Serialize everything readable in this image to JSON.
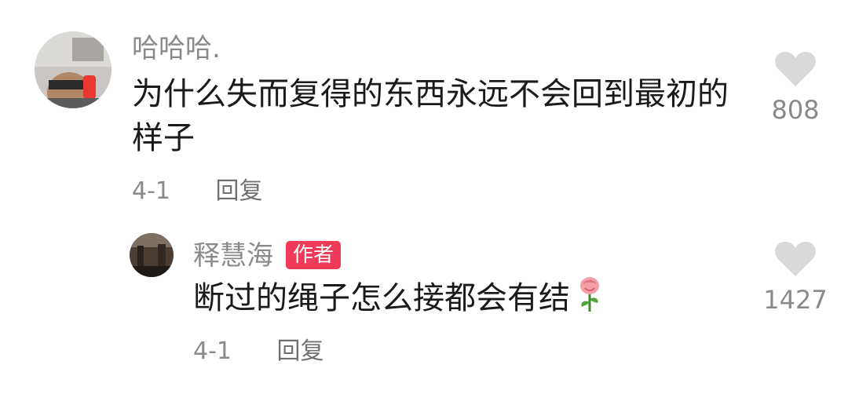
{
  "comments": [
    {
      "username": "哈哈哈.",
      "content": "为什么失而复得的东西永远不会回到最初的样子",
      "date": "4-1",
      "reply_label": "回复",
      "like_count": "808",
      "avatar_icon": "user-photo-avatar"
    }
  ],
  "reply": {
    "username": "释慧海",
    "badge": "作者",
    "content": "断过的绳子怎么接都会有结",
    "emoji": "rose-emoji",
    "date": "4-1",
    "reply_label": "回复",
    "like_count": "1427",
    "avatar_icon": "user-photo-avatar"
  },
  "colors": {
    "badge": "#f03b58",
    "heart": "#d9d9d9",
    "meta_text": "#8a8a8a"
  }
}
